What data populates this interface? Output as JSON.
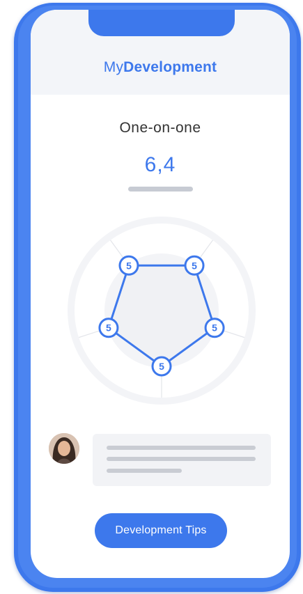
{
  "app": {
    "title_prefix": "My",
    "title_bold": "Development"
  },
  "section": {
    "title": "One-on-one"
  },
  "score": {
    "value": "6,4"
  },
  "radar": {
    "axes": 5,
    "values": [
      5,
      5,
      5,
      5,
      5
    ],
    "max": 10,
    "accent_color": "#3d78ec"
  },
  "comment": {
    "avatar_icon": "user-avatar"
  },
  "actions": {
    "tips_label": "Development Tips"
  },
  "colors": {
    "brand": "#3d78ec",
    "header_bg": "#f3f5f9"
  }
}
